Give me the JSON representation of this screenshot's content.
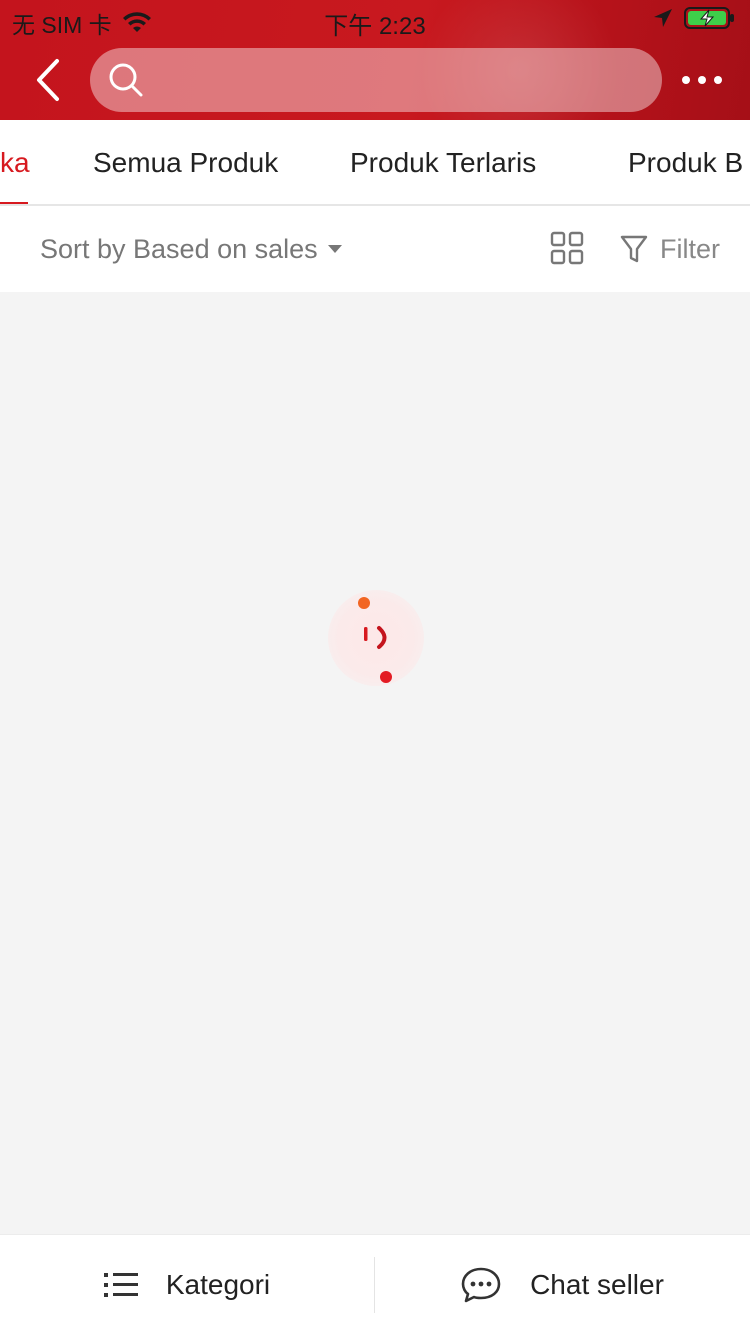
{
  "status_bar": {
    "carrier": "无 SIM 卡",
    "time": "下午 2:23"
  },
  "nav": {
    "search_placeholder": ""
  },
  "tabs": [
    {
      "label": "ka",
      "active": true
    },
    {
      "label": "Semua Produk",
      "active": false
    },
    {
      "label": "Produk Terlaris",
      "active": false
    },
    {
      "label": "Produk B",
      "active": false
    }
  ],
  "sort_bar": {
    "sort_label": "Sort by Based on sales",
    "filter_label": "Filter"
  },
  "bottom_bar": {
    "category_label": "Kategori",
    "chat_label": "Chat seller"
  },
  "icons": {
    "back": "chevron-left-icon",
    "search": "search-icon",
    "more": "more-dots-icon",
    "grid_view": "grid-view-icon",
    "filter": "funnel-icon",
    "category": "list-icon",
    "chat": "chat-bubble-icon",
    "loading": "loading-spinner-icon"
  },
  "colors": {
    "brand": "#d7191f",
    "header_gradient_start": "#c4141d",
    "header_gradient_end": "#a50f17",
    "loader_orange": "#f26522"
  }
}
